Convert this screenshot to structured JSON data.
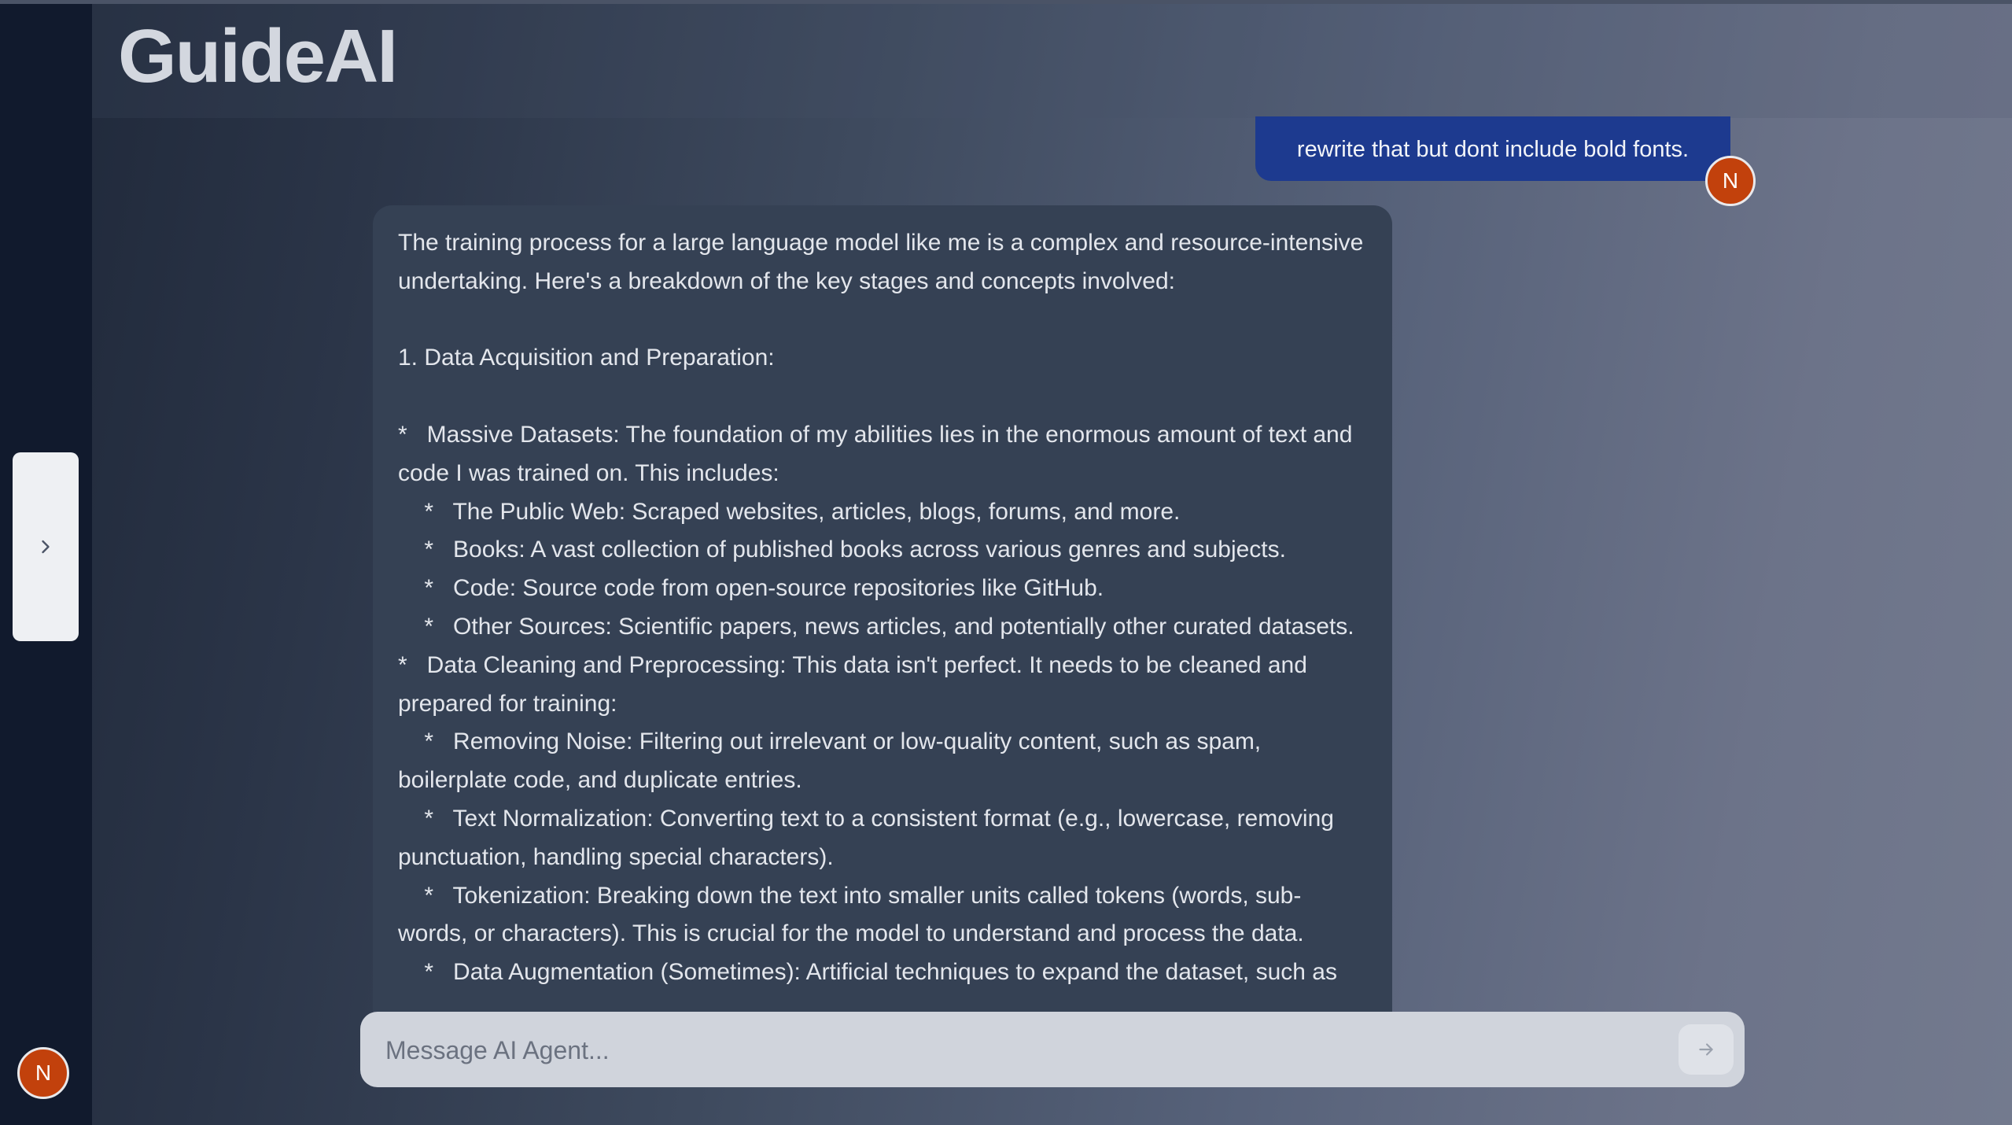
{
  "app": {
    "title": "GuideAI"
  },
  "sidebar": {
    "toggle_icon": "chevron-right-icon",
    "user_initial": "N"
  },
  "conversation": {
    "user_message": "rewrite that but dont include bold fonts.",
    "user_initial": "N",
    "assistant_message": "The training process for a large language model like me is a complex and resource-intensive undertaking. Here's a breakdown of the key stages and concepts involved:\n\n1. Data Acquisition and Preparation:\n\n*   Massive Datasets: The foundation of my abilities lies in the enormous amount of text and code I was trained on. This includes:\n    *   The Public Web: Scraped websites, articles, blogs, forums, and more.\n    *   Books: A vast collection of published books across various genres and subjects.\n    *   Code: Source code from open-source repositories like GitHub.\n    *   Other Sources: Scientific papers, news articles, and potentially other curated datasets.\n*   Data Cleaning and Preprocessing: This data isn't perfect. It needs to be cleaned and prepared for training:\n    *   Removing Noise: Filtering out irrelevant or low-quality content, such as spam, boilerplate code, and duplicate entries.\n    *   Text Normalization: Converting text to a consistent format (e.g., lowercase, removing punctuation, handling special characters).\n    *   Tokenization: Breaking down the text into smaller units called tokens (words, sub-words, or characters). This is crucial for the model to understand and process the data.\n    *   Data Augmentation (Sometimes): Artificial techniques to expand the dataset, such as"
  },
  "composer": {
    "placeholder": "Message AI Agent...",
    "value": "",
    "send_icon": "arrow-right-icon"
  },
  "colors": {
    "sidebar_bg": "#111a2d",
    "user_bubble": "#1d3a8f",
    "assistant_bubble": "#354154",
    "avatar": "#c2410c",
    "composer_bg": "#d0d4dc"
  }
}
